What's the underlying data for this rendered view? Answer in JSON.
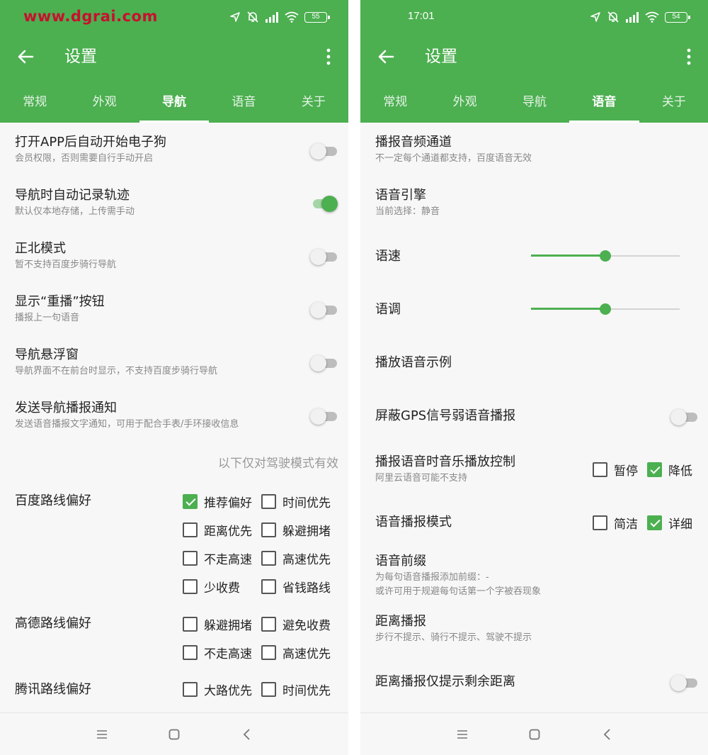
{
  "watermark": "www.dgrai.com",
  "colors": {
    "accent": "#4caf50",
    "watermark": "#c8102e"
  },
  "left": {
    "status": {
      "time": "",
      "battery": "55",
      "icons": [
        "location-icon",
        "mute-icon",
        "signal-icon",
        "wifi-icon",
        "battery-icon"
      ]
    },
    "appbar": {
      "title": "设置"
    },
    "tabs": [
      "常规",
      "外观",
      "导航",
      "语音",
      "关于"
    ],
    "active_tab": "导航",
    "settings": [
      {
        "title": "打开APP后自动开始电子狗",
        "subtitle": "会员权限，否则需要自行手动开启",
        "on": false
      },
      {
        "title": "导航时自动记录轨迹",
        "subtitle": "默认仅本地存储，上传需手动",
        "on": true
      },
      {
        "title": "正北模式",
        "subtitle": "暂不支持百度步骑行导航",
        "on": false
      },
      {
        "title": "显示“重播”按钮",
        "subtitle": "播报上一句语音",
        "on": false
      },
      {
        "title": "导航悬浮窗",
        "subtitle": "导航界面不在前台时显示，不支持百度步骑行导航",
        "on": false
      },
      {
        "title": "发送导航播报通知",
        "subtitle": "发送语音播报文字通知，可用于配合手表/手环接收信息",
        "on": false
      }
    ],
    "driving_note": "以下仅对驾驶模式有效",
    "route_groups": [
      {
        "label": "百度路线偏好",
        "options": [
          {
            "label": "推荐偏好",
            "checked": true
          },
          {
            "label": "时间优先",
            "checked": false
          },
          {
            "label": "距离优先",
            "checked": false
          },
          {
            "label": "躲避拥堵",
            "checked": false
          },
          {
            "label": "不走高速",
            "checked": false
          },
          {
            "label": "高速优先",
            "checked": false
          },
          {
            "label": "少收费",
            "checked": false
          },
          {
            "label": "省钱路线",
            "checked": false
          }
        ]
      },
      {
        "label": "高德路线偏好",
        "options": [
          {
            "label": "躲避拥堵",
            "checked": false
          },
          {
            "label": "避免收费",
            "checked": false
          },
          {
            "label": "不走高速",
            "checked": false
          },
          {
            "label": "高速优先",
            "checked": false
          }
        ]
      },
      {
        "label": "腾讯路线偏好",
        "options": [
          {
            "label": "大路优先",
            "checked": false
          },
          {
            "label": "时间优先",
            "checked": false
          }
        ]
      }
    ]
  },
  "right": {
    "status": {
      "time": "17:01",
      "battery": "54",
      "icons": [
        "location-icon",
        "mute-icon",
        "signal-icon",
        "wifi-icon",
        "battery-icon"
      ]
    },
    "appbar": {
      "title": "设置"
    },
    "tabs": [
      "常规",
      "外观",
      "导航",
      "语音",
      "关于"
    ],
    "active_tab": "语音",
    "audio_channel": {
      "title": "播报音频通道",
      "subtitle": "不一定每个通道都支持，百度语音无效"
    },
    "engine": {
      "title": "语音引擎",
      "subtitle": "当前选择：静音"
    },
    "speed": {
      "label": "语速",
      "value": 0.5
    },
    "pitch": {
      "label": "语调",
      "value": 0.5
    },
    "sample": {
      "title": "播放语音示例"
    },
    "gps_weak": {
      "title": "屏蔽GPS信号弱语音播报",
      "on": false
    },
    "music_control": {
      "title": "播报语音时音乐播放控制",
      "subtitle": "阿里云语音可能不支持",
      "options": [
        {
          "label": "暂停",
          "checked": false
        },
        {
          "label": "降低",
          "checked": true
        }
      ]
    },
    "mode": {
      "title": "语音播报模式",
      "options": [
        {
          "label": "简洁",
          "checked": false
        },
        {
          "label": "详细",
          "checked": true
        }
      ]
    },
    "prefix": {
      "title": "语音前缀",
      "subtitle1": "为每句语音播报添加前缀：-",
      "subtitle2": "或许可用于规避每句话第一个字被吞现象"
    },
    "distance": {
      "title": "距离播报",
      "subtitle": "步行不提示、骑行不提示、驾驶不提示"
    },
    "distance_remaining": {
      "title": "距离播报仅提示剩余距离",
      "on": false
    }
  },
  "navbar": [
    "menu-icon",
    "home-icon",
    "back-icon"
  ]
}
